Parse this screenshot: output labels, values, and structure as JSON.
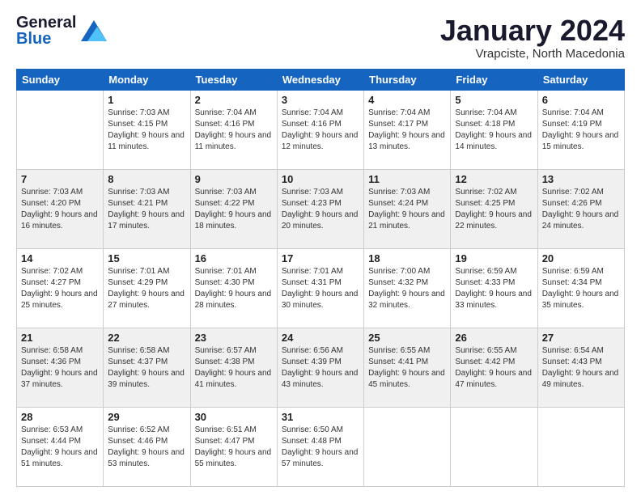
{
  "header": {
    "logo_general": "General",
    "logo_blue": "Blue",
    "month_title": "January 2024",
    "location": "Vrapciste, North Macedonia"
  },
  "days_of_week": [
    "Sunday",
    "Monday",
    "Tuesday",
    "Wednesday",
    "Thursday",
    "Friday",
    "Saturday"
  ],
  "weeks": [
    [
      {
        "day": "",
        "sunrise": "",
        "sunset": "",
        "daylight": ""
      },
      {
        "day": "1",
        "sunrise": "Sunrise: 7:03 AM",
        "sunset": "Sunset: 4:15 PM",
        "daylight": "Daylight: 9 hours and 11 minutes."
      },
      {
        "day": "2",
        "sunrise": "Sunrise: 7:04 AM",
        "sunset": "Sunset: 4:16 PM",
        "daylight": "Daylight: 9 hours and 11 minutes."
      },
      {
        "day": "3",
        "sunrise": "Sunrise: 7:04 AM",
        "sunset": "Sunset: 4:16 PM",
        "daylight": "Daylight: 9 hours and 12 minutes."
      },
      {
        "day": "4",
        "sunrise": "Sunrise: 7:04 AM",
        "sunset": "Sunset: 4:17 PM",
        "daylight": "Daylight: 9 hours and 13 minutes."
      },
      {
        "day": "5",
        "sunrise": "Sunrise: 7:04 AM",
        "sunset": "Sunset: 4:18 PM",
        "daylight": "Daylight: 9 hours and 14 minutes."
      },
      {
        "day": "6",
        "sunrise": "Sunrise: 7:04 AM",
        "sunset": "Sunset: 4:19 PM",
        "daylight": "Daylight: 9 hours and 15 minutes."
      }
    ],
    [
      {
        "day": "7",
        "sunrise": "Sunrise: 7:03 AM",
        "sunset": "Sunset: 4:20 PM",
        "daylight": "Daylight: 9 hours and 16 minutes."
      },
      {
        "day": "8",
        "sunrise": "Sunrise: 7:03 AM",
        "sunset": "Sunset: 4:21 PM",
        "daylight": "Daylight: 9 hours and 17 minutes."
      },
      {
        "day": "9",
        "sunrise": "Sunrise: 7:03 AM",
        "sunset": "Sunset: 4:22 PM",
        "daylight": "Daylight: 9 hours and 18 minutes."
      },
      {
        "day": "10",
        "sunrise": "Sunrise: 7:03 AM",
        "sunset": "Sunset: 4:23 PM",
        "daylight": "Daylight: 9 hours and 20 minutes."
      },
      {
        "day": "11",
        "sunrise": "Sunrise: 7:03 AM",
        "sunset": "Sunset: 4:24 PM",
        "daylight": "Daylight: 9 hours and 21 minutes."
      },
      {
        "day": "12",
        "sunrise": "Sunrise: 7:02 AM",
        "sunset": "Sunset: 4:25 PM",
        "daylight": "Daylight: 9 hours and 22 minutes."
      },
      {
        "day": "13",
        "sunrise": "Sunrise: 7:02 AM",
        "sunset": "Sunset: 4:26 PM",
        "daylight": "Daylight: 9 hours and 24 minutes."
      }
    ],
    [
      {
        "day": "14",
        "sunrise": "Sunrise: 7:02 AM",
        "sunset": "Sunset: 4:27 PM",
        "daylight": "Daylight: 9 hours and 25 minutes."
      },
      {
        "day": "15",
        "sunrise": "Sunrise: 7:01 AM",
        "sunset": "Sunset: 4:29 PM",
        "daylight": "Daylight: 9 hours and 27 minutes."
      },
      {
        "day": "16",
        "sunrise": "Sunrise: 7:01 AM",
        "sunset": "Sunset: 4:30 PM",
        "daylight": "Daylight: 9 hours and 28 minutes."
      },
      {
        "day": "17",
        "sunrise": "Sunrise: 7:01 AM",
        "sunset": "Sunset: 4:31 PM",
        "daylight": "Daylight: 9 hours and 30 minutes."
      },
      {
        "day": "18",
        "sunrise": "Sunrise: 7:00 AM",
        "sunset": "Sunset: 4:32 PM",
        "daylight": "Daylight: 9 hours and 32 minutes."
      },
      {
        "day": "19",
        "sunrise": "Sunrise: 6:59 AM",
        "sunset": "Sunset: 4:33 PM",
        "daylight": "Daylight: 9 hours and 33 minutes."
      },
      {
        "day": "20",
        "sunrise": "Sunrise: 6:59 AM",
        "sunset": "Sunset: 4:34 PM",
        "daylight": "Daylight: 9 hours and 35 minutes."
      }
    ],
    [
      {
        "day": "21",
        "sunrise": "Sunrise: 6:58 AM",
        "sunset": "Sunset: 4:36 PM",
        "daylight": "Daylight: 9 hours and 37 minutes."
      },
      {
        "day": "22",
        "sunrise": "Sunrise: 6:58 AM",
        "sunset": "Sunset: 4:37 PM",
        "daylight": "Daylight: 9 hours and 39 minutes."
      },
      {
        "day": "23",
        "sunrise": "Sunrise: 6:57 AM",
        "sunset": "Sunset: 4:38 PM",
        "daylight": "Daylight: 9 hours and 41 minutes."
      },
      {
        "day": "24",
        "sunrise": "Sunrise: 6:56 AM",
        "sunset": "Sunset: 4:39 PM",
        "daylight": "Daylight: 9 hours and 43 minutes."
      },
      {
        "day": "25",
        "sunrise": "Sunrise: 6:55 AM",
        "sunset": "Sunset: 4:41 PM",
        "daylight": "Daylight: 9 hours and 45 minutes."
      },
      {
        "day": "26",
        "sunrise": "Sunrise: 6:55 AM",
        "sunset": "Sunset: 4:42 PM",
        "daylight": "Daylight: 9 hours and 47 minutes."
      },
      {
        "day": "27",
        "sunrise": "Sunrise: 6:54 AM",
        "sunset": "Sunset: 4:43 PM",
        "daylight": "Daylight: 9 hours and 49 minutes."
      }
    ],
    [
      {
        "day": "28",
        "sunrise": "Sunrise: 6:53 AM",
        "sunset": "Sunset: 4:44 PM",
        "daylight": "Daylight: 9 hours and 51 minutes."
      },
      {
        "day": "29",
        "sunrise": "Sunrise: 6:52 AM",
        "sunset": "Sunset: 4:46 PM",
        "daylight": "Daylight: 9 hours and 53 minutes."
      },
      {
        "day": "30",
        "sunrise": "Sunrise: 6:51 AM",
        "sunset": "Sunset: 4:47 PM",
        "daylight": "Daylight: 9 hours and 55 minutes."
      },
      {
        "day": "31",
        "sunrise": "Sunrise: 6:50 AM",
        "sunset": "Sunset: 4:48 PM",
        "daylight": "Daylight: 9 hours and 57 minutes."
      },
      {
        "day": "",
        "sunrise": "",
        "sunset": "",
        "daylight": ""
      },
      {
        "day": "",
        "sunrise": "",
        "sunset": "",
        "daylight": ""
      },
      {
        "day": "",
        "sunrise": "",
        "sunset": "",
        "daylight": ""
      }
    ]
  ]
}
